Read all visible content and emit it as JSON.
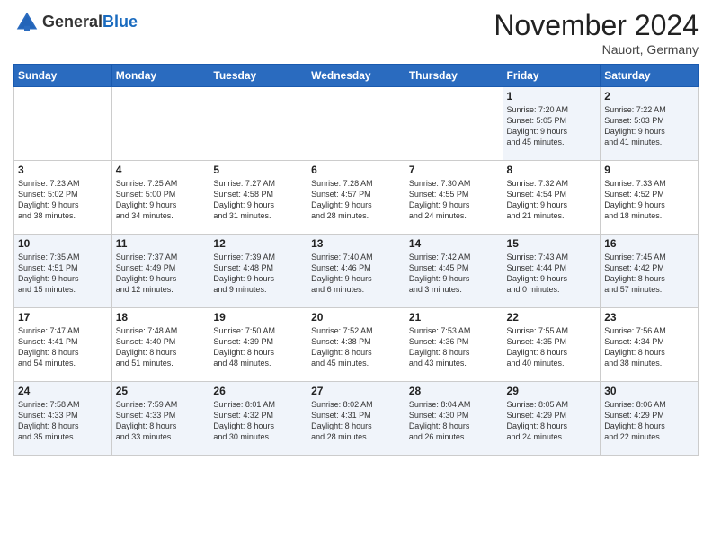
{
  "header": {
    "logo_general": "General",
    "logo_blue": "Blue",
    "month": "November 2024",
    "location": "Nauort, Germany"
  },
  "weekdays": [
    "Sunday",
    "Monday",
    "Tuesday",
    "Wednesday",
    "Thursday",
    "Friday",
    "Saturday"
  ],
  "weeks": [
    [
      {
        "day": "",
        "info": ""
      },
      {
        "day": "",
        "info": ""
      },
      {
        "day": "",
        "info": ""
      },
      {
        "day": "",
        "info": ""
      },
      {
        "day": "",
        "info": ""
      },
      {
        "day": "1",
        "info": "Sunrise: 7:20 AM\nSunset: 5:05 PM\nDaylight: 9 hours\nand 45 minutes."
      },
      {
        "day": "2",
        "info": "Sunrise: 7:22 AM\nSunset: 5:03 PM\nDaylight: 9 hours\nand 41 minutes."
      }
    ],
    [
      {
        "day": "3",
        "info": "Sunrise: 7:23 AM\nSunset: 5:02 PM\nDaylight: 9 hours\nand 38 minutes."
      },
      {
        "day": "4",
        "info": "Sunrise: 7:25 AM\nSunset: 5:00 PM\nDaylight: 9 hours\nand 34 minutes."
      },
      {
        "day": "5",
        "info": "Sunrise: 7:27 AM\nSunset: 4:58 PM\nDaylight: 9 hours\nand 31 minutes."
      },
      {
        "day": "6",
        "info": "Sunrise: 7:28 AM\nSunset: 4:57 PM\nDaylight: 9 hours\nand 28 minutes."
      },
      {
        "day": "7",
        "info": "Sunrise: 7:30 AM\nSunset: 4:55 PM\nDaylight: 9 hours\nand 24 minutes."
      },
      {
        "day": "8",
        "info": "Sunrise: 7:32 AM\nSunset: 4:54 PM\nDaylight: 9 hours\nand 21 minutes."
      },
      {
        "day": "9",
        "info": "Sunrise: 7:33 AM\nSunset: 4:52 PM\nDaylight: 9 hours\nand 18 minutes."
      }
    ],
    [
      {
        "day": "10",
        "info": "Sunrise: 7:35 AM\nSunset: 4:51 PM\nDaylight: 9 hours\nand 15 minutes."
      },
      {
        "day": "11",
        "info": "Sunrise: 7:37 AM\nSunset: 4:49 PM\nDaylight: 9 hours\nand 12 minutes."
      },
      {
        "day": "12",
        "info": "Sunrise: 7:39 AM\nSunset: 4:48 PM\nDaylight: 9 hours\nand 9 minutes."
      },
      {
        "day": "13",
        "info": "Sunrise: 7:40 AM\nSunset: 4:46 PM\nDaylight: 9 hours\nand 6 minutes."
      },
      {
        "day": "14",
        "info": "Sunrise: 7:42 AM\nSunset: 4:45 PM\nDaylight: 9 hours\nand 3 minutes."
      },
      {
        "day": "15",
        "info": "Sunrise: 7:43 AM\nSunset: 4:44 PM\nDaylight: 9 hours\nand 0 minutes."
      },
      {
        "day": "16",
        "info": "Sunrise: 7:45 AM\nSunset: 4:42 PM\nDaylight: 8 hours\nand 57 minutes."
      }
    ],
    [
      {
        "day": "17",
        "info": "Sunrise: 7:47 AM\nSunset: 4:41 PM\nDaylight: 8 hours\nand 54 minutes."
      },
      {
        "day": "18",
        "info": "Sunrise: 7:48 AM\nSunset: 4:40 PM\nDaylight: 8 hours\nand 51 minutes."
      },
      {
        "day": "19",
        "info": "Sunrise: 7:50 AM\nSunset: 4:39 PM\nDaylight: 8 hours\nand 48 minutes."
      },
      {
        "day": "20",
        "info": "Sunrise: 7:52 AM\nSunset: 4:38 PM\nDaylight: 8 hours\nand 45 minutes."
      },
      {
        "day": "21",
        "info": "Sunrise: 7:53 AM\nSunset: 4:36 PM\nDaylight: 8 hours\nand 43 minutes."
      },
      {
        "day": "22",
        "info": "Sunrise: 7:55 AM\nSunset: 4:35 PM\nDaylight: 8 hours\nand 40 minutes."
      },
      {
        "day": "23",
        "info": "Sunrise: 7:56 AM\nSunset: 4:34 PM\nDaylight: 8 hours\nand 38 minutes."
      }
    ],
    [
      {
        "day": "24",
        "info": "Sunrise: 7:58 AM\nSunset: 4:33 PM\nDaylight: 8 hours\nand 35 minutes."
      },
      {
        "day": "25",
        "info": "Sunrise: 7:59 AM\nSunset: 4:33 PM\nDaylight: 8 hours\nand 33 minutes."
      },
      {
        "day": "26",
        "info": "Sunrise: 8:01 AM\nSunset: 4:32 PM\nDaylight: 8 hours\nand 30 minutes."
      },
      {
        "day": "27",
        "info": "Sunrise: 8:02 AM\nSunset: 4:31 PM\nDaylight: 8 hours\nand 28 minutes."
      },
      {
        "day": "28",
        "info": "Sunrise: 8:04 AM\nSunset: 4:30 PM\nDaylight: 8 hours\nand 26 minutes."
      },
      {
        "day": "29",
        "info": "Sunrise: 8:05 AM\nSunset: 4:29 PM\nDaylight: 8 hours\nand 24 minutes."
      },
      {
        "day": "30",
        "info": "Sunrise: 8:06 AM\nSunset: 4:29 PM\nDaylight: 8 hours\nand 22 minutes."
      }
    ]
  ]
}
